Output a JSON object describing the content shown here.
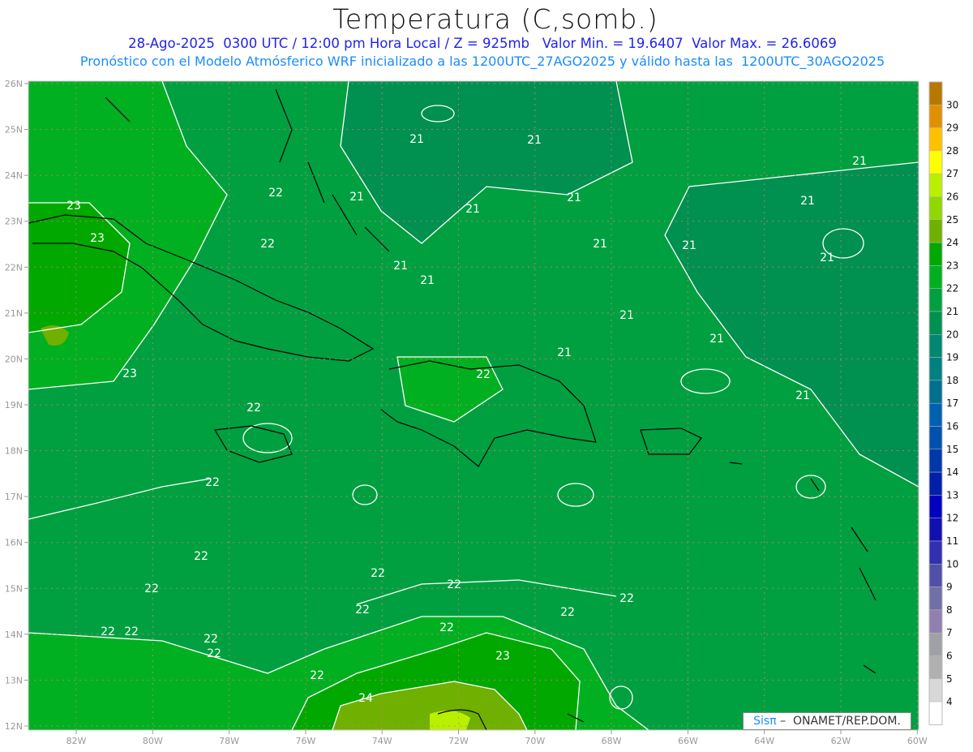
{
  "header": {
    "title": "Temperatura (C,somb.)",
    "subtitle": "28-Ago-2025  0300 UTC / 12:00 pm Hora Local / Z = 925mb   Valor Min. = 19.6407  Valor Max. = 26.6069",
    "model_info": "Pronóstico con el Modelo Atmósferico WRF inicializado a las 1200UTC_27AGO2025 y válido hasta las  1200UTC_30AGO2025"
  },
  "map": {
    "lat_labels": [
      "26N",
      "25N",
      "24N",
      "23N",
      "22N",
      "21N",
      "20N",
      "19N",
      "18N",
      "17N",
      "16N",
      "15N",
      "14N",
      "13N",
      "12N"
    ],
    "lon_labels": [
      "82W",
      "80W",
      "78W",
      "76W",
      "74W",
      "72W",
      "70W",
      "68W",
      "66W",
      "64W",
      "62W",
      "60W"
    ],
    "contour_labels": [
      "21",
      "21",
      "21",
      "21",
      "21",
      "21",
      "21",
      "21",
      "21",
      "21",
      "21",
      "21",
      "21",
      "21",
      "21",
      "21",
      "22",
      "22",
      "22",
      "22",
      "22",
      "22",
      "22",
      "22",
      "22",
      "22",
      "22",
      "22",
      "22",
      "22",
      "22",
      "22",
      "22",
      "22",
      "23",
      "23",
      "23",
      "23",
      "24"
    ]
  },
  "colorbar": {
    "labels": [
      "30",
      "29",
      "28",
      "27",
      "26",
      "25",
      "24",
      "23",
      "22",
      "21",
      "20",
      "19",
      "18",
      "17",
      "16",
      "15",
      "14",
      "13",
      "12",
      "11",
      "10",
      "9",
      "8",
      "7",
      "6",
      "5",
      "4"
    ],
    "colors": [
      "#b87800",
      "#e09000",
      "#ffc000",
      "#ffff00",
      "#b8f000",
      "#90d800",
      "#70b000",
      "#00a800",
      "#00b020",
      "#00a040",
      "#009050",
      "#008870",
      "#008080",
      "#007090",
      "#0060b0",
      "#0050b0",
      "#0038a8",
      "#0020a8",
      "#0000c0",
      "#1010b0",
      "#3030b0",
      "#5050a8",
      "#7070a8",
      "#9080b0",
      "#a0a0a8",
      "#b0b0b0",
      "#d8d8d8",
      "#ffffff"
    ]
  },
  "credit": {
    "brand": "Sisπ",
    "text": " –  ONAMET/REP.DOM."
  }
}
